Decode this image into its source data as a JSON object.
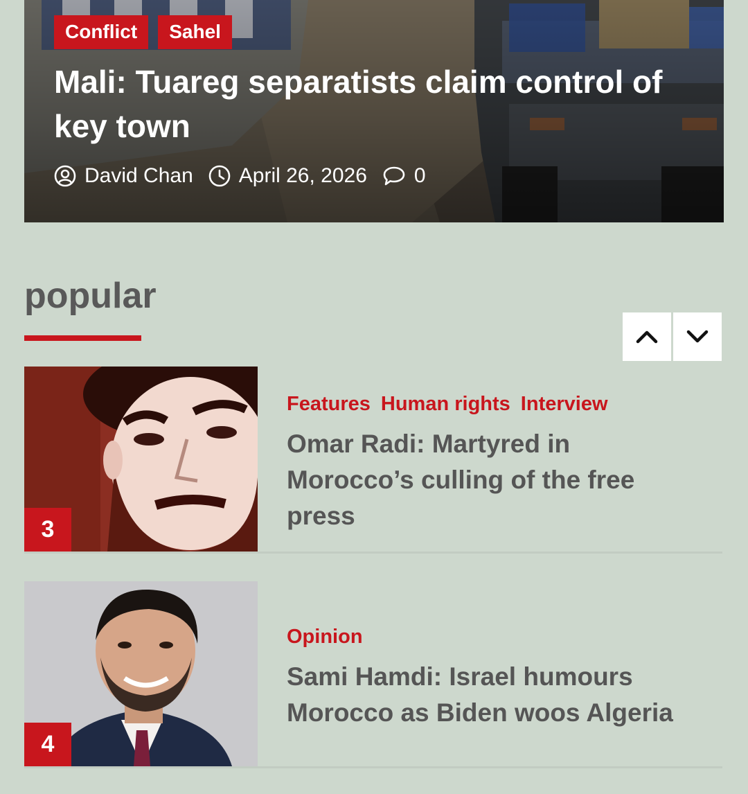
{
  "hero": {
    "tags": [
      "Conflict",
      "Sahel"
    ],
    "title": "Mali: Tuareg separatists claim control of key town",
    "author": "David Chan",
    "date": "April 26, 2026",
    "comments": "0",
    "icons": [
      "user-circle-icon",
      "clock-icon",
      "comment-icon"
    ]
  },
  "popular": {
    "title": "popular",
    "nav": {
      "prev_icon": "chevron-up-icon",
      "next_icon": "chevron-down-icon"
    },
    "articles": [
      {
        "rank": "3",
        "categories": [
          "Features",
          "Human rights",
          "Interview"
        ],
        "title": "Omar Radi: Martyred in Morocco’s culling of the free press"
      },
      {
        "rank": "4",
        "categories": [
          "Opinion"
        ],
        "title": "Sami Hamdi: Israel humours Morocco as Biden woos Algeria"
      }
    ]
  },
  "colors": {
    "accent": "#c8161d",
    "background": "#cdd8cd",
    "heading": "#595959",
    "article_title": "#555555"
  }
}
